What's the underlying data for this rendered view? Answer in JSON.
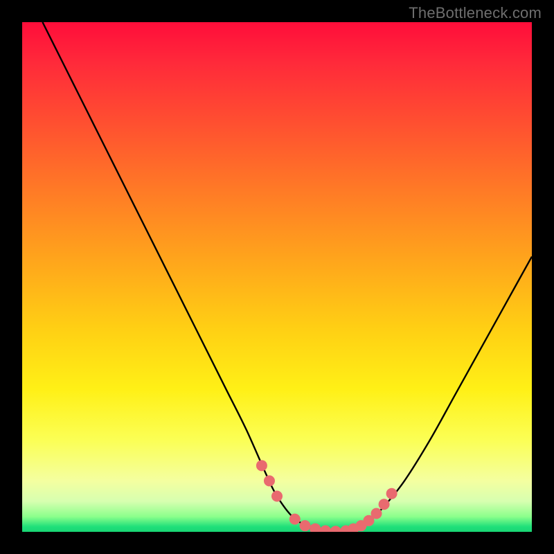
{
  "attribution": "TheBottleneck.com",
  "colors": {
    "background": "#000000",
    "curve": "#000000",
    "dot": "#e96a6f",
    "grad_top": "#ff0d3a",
    "grad_bottom": "#19d674"
  },
  "chart_data": {
    "type": "line",
    "title": "",
    "xlabel": "",
    "ylabel": "",
    "xlim": [
      0,
      100
    ],
    "ylim": [
      0,
      100
    ],
    "series": [
      {
        "name": "bottleneck-curve",
        "x": [
          4,
          8,
          12,
          16,
          20,
          24,
          28,
          32,
          36,
          40,
          44,
          48,
          50,
          53,
          56,
          58,
          60,
          62,
          64,
          66,
          68,
          71,
          75,
          80,
          85,
          90,
          95,
          100
        ],
        "y": [
          100,
          92,
          84,
          76,
          68,
          60,
          52,
          44,
          36,
          28,
          20,
          11,
          7,
          3,
          1,
          0,
          0,
          0,
          0,
          1,
          2,
          5,
          10,
          18,
          27,
          36,
          45,
          54
        ]
      }
    ],
    "dots": {
      "name": "highlight-dots",
      "x": [
        47.0,
        48.5,
        50.0,
        53.5,
        55.5,
        57.5,
        59.5,
        61.5,
        63.5,
        65.0,
        66.5,
        68.0,
        69.5,
        71.0,
        72.5
      ],
      "y": [
        13.0,
        10.0,
        7.0,
        2.5,
        1.2,
        0.6,
        0.2,
        0.1,
        0.2,
        0.6,
        1.2,
        2.2,
        3.6,
        5.4,
        7.5
      ]
    }
  }
}
